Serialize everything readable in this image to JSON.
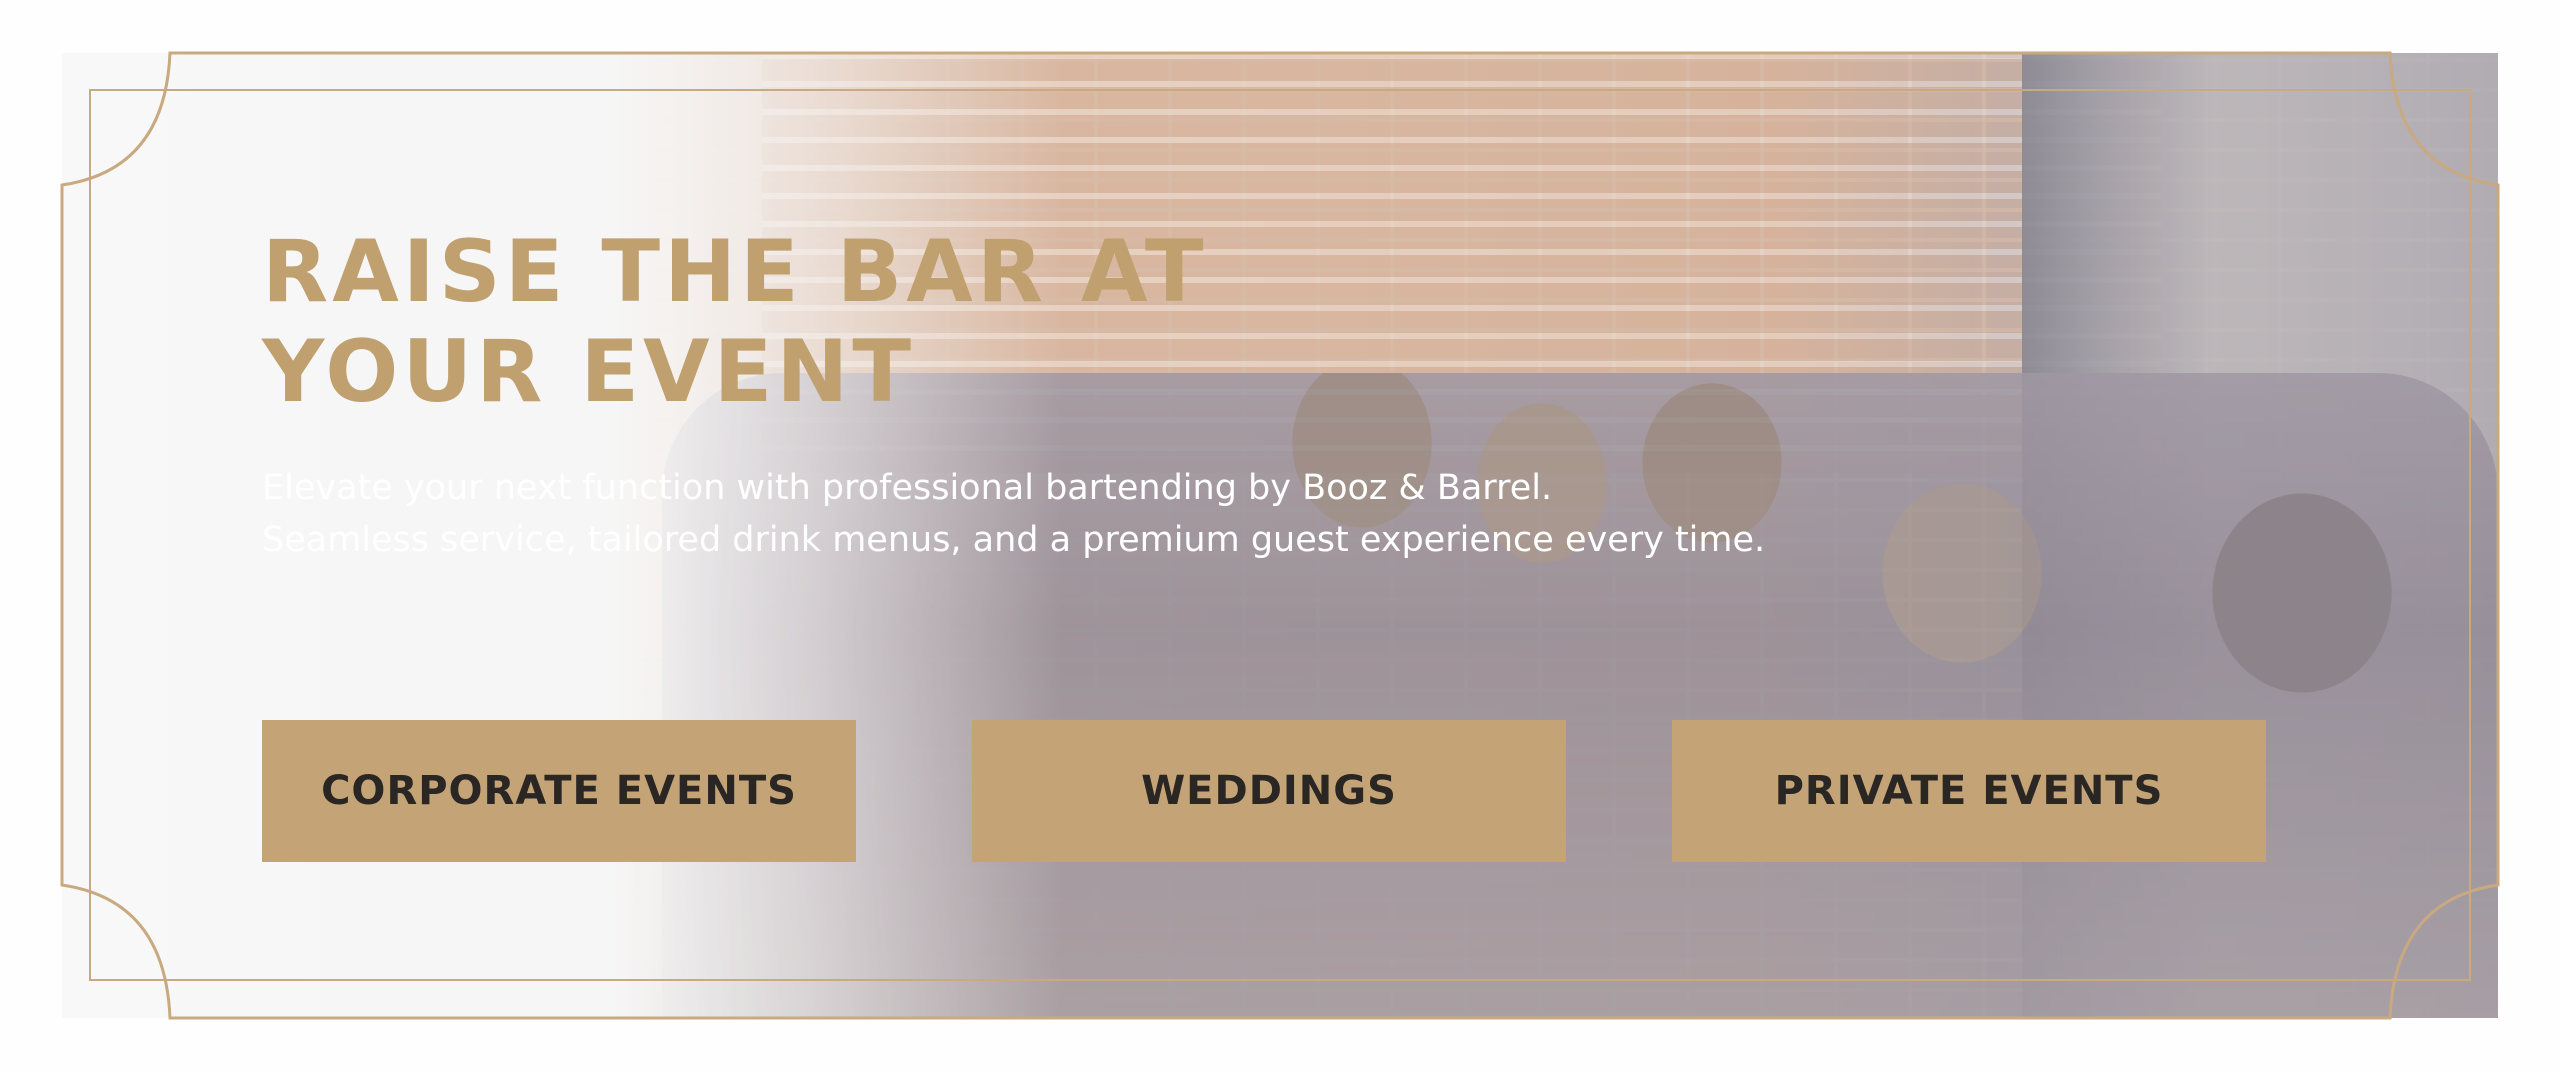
{
  "hero": {
    "headline_line1": "RAISE THE BAR AT",
    "headline_line2": "YOUR EVENT",
    "intro_line1": "Elevate your next function with professional bartending by Booz & Barrel.",
    "intro_line2": "Seamless service, tailored drink menus, and a premium guest experience every time."
  },
  "buttons": [
    {
      "label": "CORPORATE EVENTS"
    },
    {
      "label": "WEDDINGS"
    },
    {
      "label": "PRIVATE EVENTS"
    }
  ],
  "colors": {
    "accent_gold": "#c4a476",
    "headline_gold": "#bfa06e",
    "button_text": "#2a2624",
    "frame_line": "#c8a980",
    "background": "#fefefe"
  }
}
